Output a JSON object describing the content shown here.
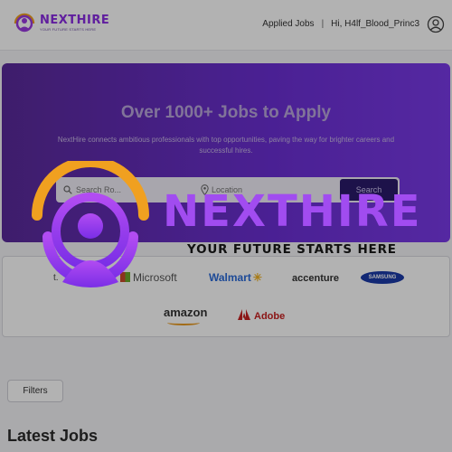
{
  "header": {
    "logo_name": "NEXTHIRE",
    "logo_tagline": "YOUR FUTURE STARTS HERE",
    "nav_applied_jobs": "Applied Jobs",
    "nav_separator": "|",
    "nav_greeting": "Hi, H4lf_Blood_Princ3",
    "user_icon": "user-circle-icon"
  },
  "hero": {
    "title": "Over 1000+ Jobs to Apply",
    "subtitle": "NextHire connects ambitious professionals with top opportunities, paving the way for brighter careers and successful hires.",
    "search_placeholder": "Search Ro...",
    "location_placeholder": "Location",
    "search_button": "Search",
    "gradient_start": "#5a2a9a",
    "gradient_end": "#7a3ae8"
  },
  "companies": {
    "partial_left": "t.",
    "microsoft": "Microsoft",
    "walmart": "Walmart",
    "accenture": "accenture",
    "samsung": "SAMSUNG",
    "amazon": "amazon",
    "adobe": "Adobe"
  },
  "filters": {
    "button_label": "Filters"
  },
  "latest": {
    "title": "Latest Jobs"
  },
  "splash": {
    "brand": "NEXTHIRE",
    "tagline": "YOUR FUTURE STARTS HERE",
    "accent_color": "#a14cf0",
    "ring_color": "#f0a020"
  }
}
